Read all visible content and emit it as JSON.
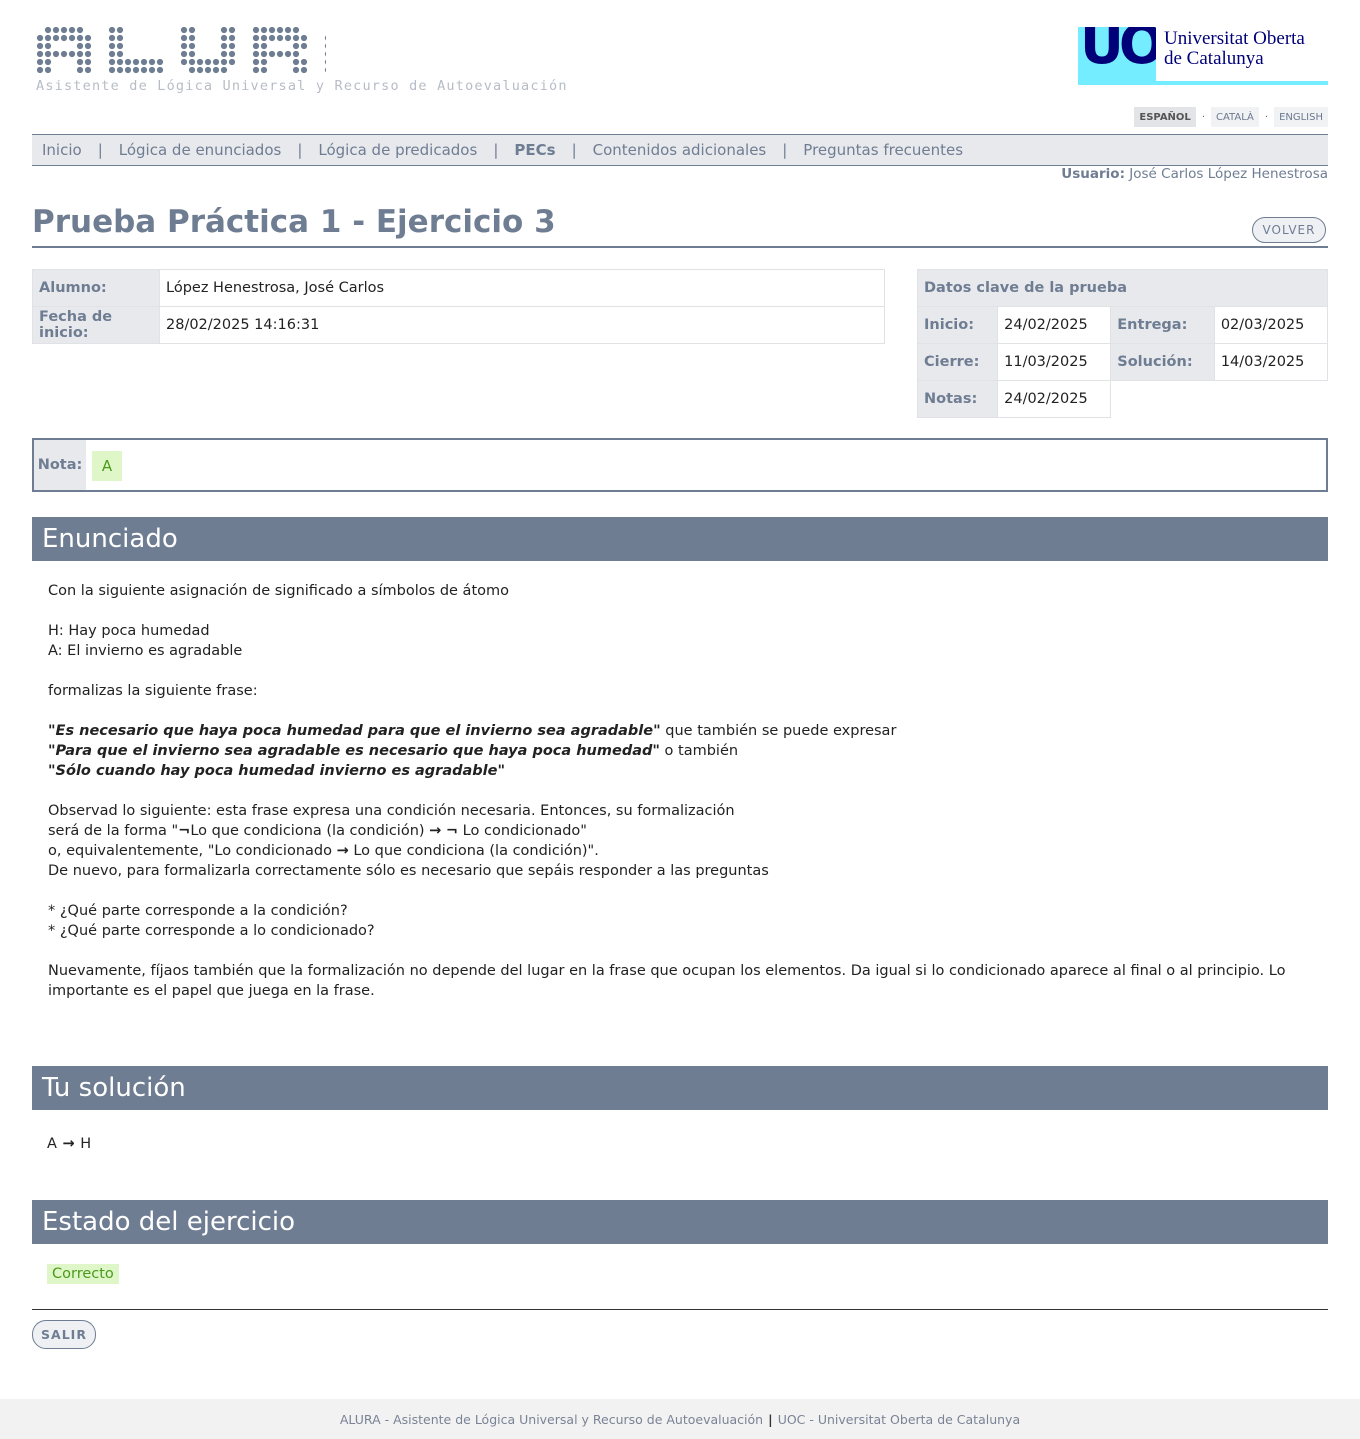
{
  "header": {
    "logo_text": "ALURA",
    "subtitle": "Asistente de Lógica Universal y Recurso de Autoevaluación",
    "uoc_mark": "UOC",
    "uoc_name_line1": "Universitat Oberta",
    "uoc_name_line2": "de Catalunya"
  },
  "languages": [
    {
      "label": "ESPAÑOL",
      "active": true
    },
    {
      "label": "CATALÀ",
      "active": false
    },
    {
      "label": "ENGLISH",
      "active": false
    }
  ],
  "lang_separator": "·",
  "nav": {
    "items": [
      "Inicio",
      "Lógica de enunciados",
      "Lógica de predicados",
      "PECs",
      "Contenidos adicionales",
      "Preguntas frecuentes"
    ],
    "separator": "|",
    "active": "PECs"
  },
  "user": {
    "label": "Usuario:",
    "name": "José Carlos López Henestrosa"
  },
  "page_title": "Prueba Práctica 1 - Ejercicio 3",
  "volver_label": "VOLVER",
  "student": {
    "alumno_label": "Alumno:",
    "alumno_value": "López Henestrosa, José Carlos",
    "fecha_label": "Fecha de inicio:",
    "fecha_value": "28/02/2025 14:16:31"
  },
  "key_dates": {
    "title": "Datos clave de la prueba",
    "inicio_label": "Inicio:",
    "inicio_value": "24/02/2025",
    "entrega_label": "Entrega:",
    "entrega_value": "02/03/2025",
    "cierre_label": "Cierre:",
    "cierre_value": "11/03/2025",
    "solucion_label": "Solución:",
    "solucion_value": "14/03/2025",
    "notas_label": "Notas:",
    "notas_value": "24/02/2025"
  },
  "grade": {
    "label": "Nota:",
    "value": "A"
  },
  "sections": {
    "enunciado": "Enunciado",
    "solucion": "Tu solución",
    "estado": "Estado del ejercicio"
  },
  "statement": {
    "intro": "Con la siguiente asignación de significado a símbolos de átomo",
    "atom_h": "H: Hay poca humedad",
    "atom_a": "A: El invierno es agradable",
    "formalize": "formalizas la siguiente frase:",
    "quote1": "\"Es necesario que haya poca humedad para que el invierno sea agradable\"",
    "quote1_after": " que también se puede expresar",
    "quote2": "\"Para que el invierno sea agradable es necesario que haya poca humedad\"",
    "quote2_after": " o también",
    "quote3": "\"Sólo cuando hay poca humedad invierno es agradable\"",
    "obs1": "Observad lo siguiente: esta frase expresa una condición necesaria. Entonces, su formalización",
    "obs2_a": "será de la forma \"",
    "obs2_b": "Lo que condiciona (la condición) ",
    "obs2_c": " Lo condicionado\"",
    "obs3_a": "o, equivalentemente, \"Lo condicionado ",
    "obs3_b": " Lo que condiciona (la condición)\".",
    "obs4": "De nuevo, para formalizarla correctamente sólo es necesario que sepáis responder a las preguntas",
    "q1": "* ¿Qué parte corresponde a la condición?",
    "q2": "* ¿Qué parte corresponde a lo condicionado?",
    "final": "Nuevamente, fíjaos también que la formalización no depende del lugar en la frase que ocupan los elementos. Da igual si lo condicionado aparece al final o al principio. Lo importante es el papel que juega en la frase.",
    "neg_symbol": "¬",
    "arrow_symbol": "→"
  },
  "solution": {
    "left": "A",
    "arrow": "→",
    "right": "H"
  },
  "status": "Correcto",
  "salir_label": "SALIR",
  "footer": {
    "left": "ALURA - Asistente de Lógica Universal y Recurso de Autoevaluación",
    "separator": "|",
    "right": "UOC - Universitat Oberta de Catalunya"
  }
}
